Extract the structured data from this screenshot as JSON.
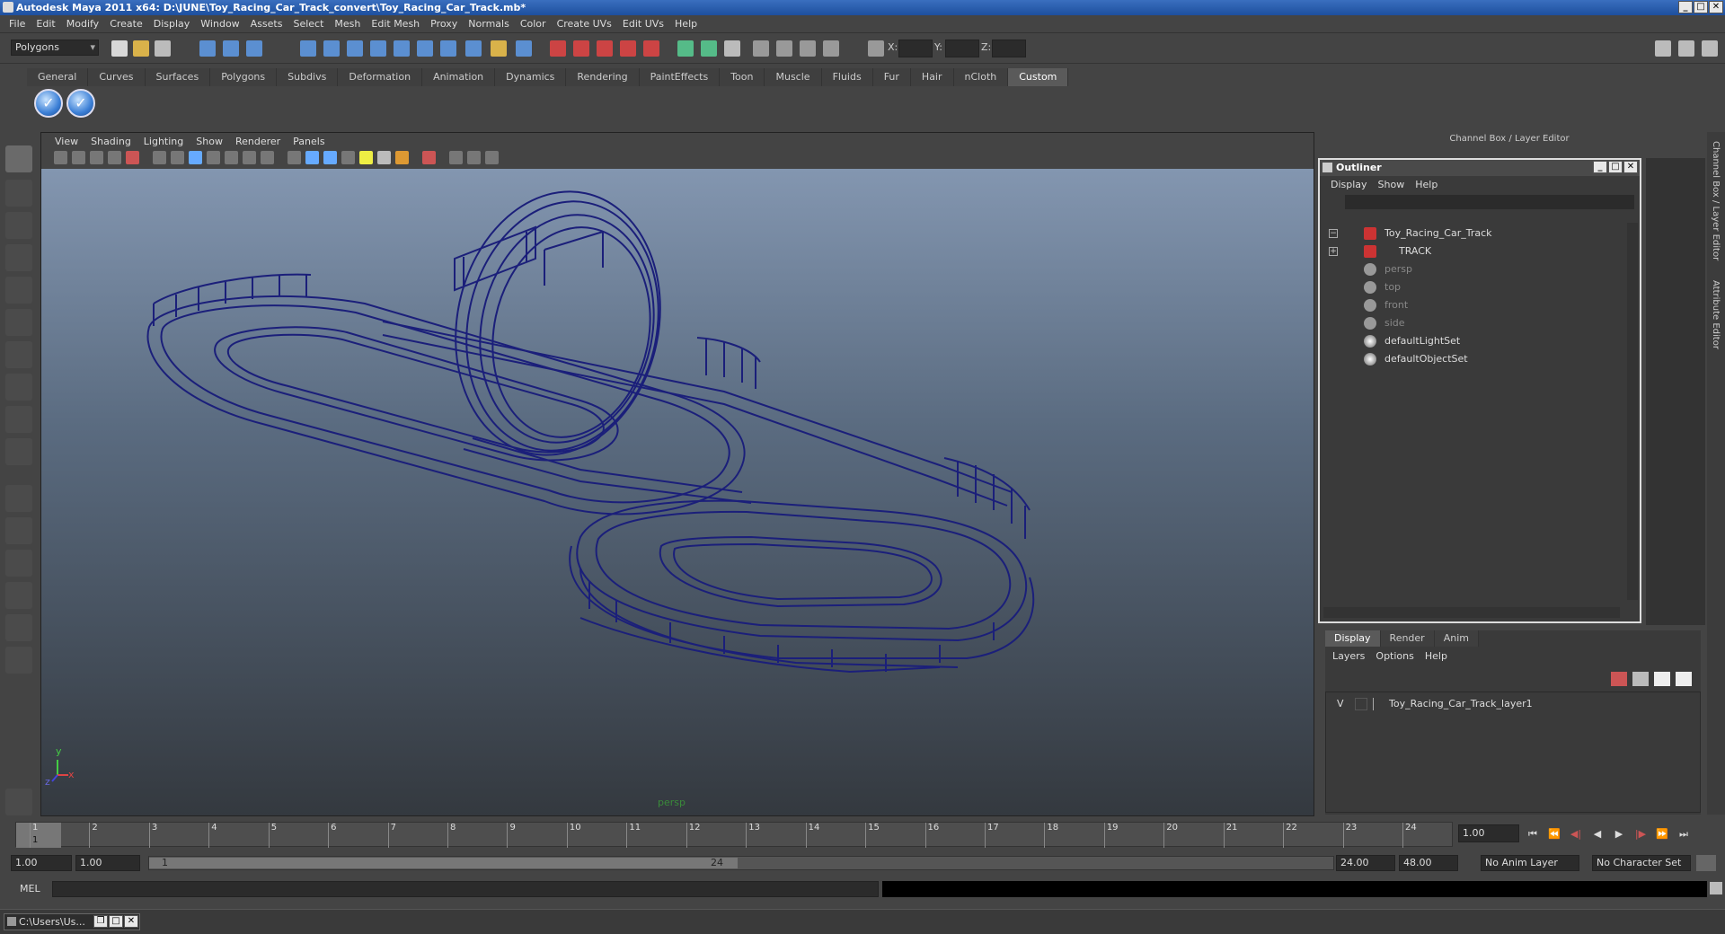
{
  "window": {
    "title": "Autodesk Maya 2011 x64: D:\\JUNE\\Toy_Racing_Car_Track_convert\\Toy_Racing_Car_Track.mb*"
  },
  "menubar": [
    "File",
    "Edit",
    "Modify",
    "Create",
    "Display",
    "Window",
    "Assets",
    "Select",
    "Mesh",
    "Edit Mesh",
    "Proxy",
    "Normals",
    "Color",
    "Create UVs",
    "Edit UVs",
    "Help"
  ],
  "statusline": {
    "mode": "Polygons",
    "x_label": "X:",
    "y_label": "Y:",
    "z_label": "Z:"
  },
  "shelf": {
    "tabs": [
      "General",
      "Curves",
      "Surfaces",
      "Polygons",
      "Subdivs",
      "Deformation",
      "Animation",
      "Dynamics",
      "Rendering",
      "PaintEffects",
      "Toon",
      "Muscle",
      "Fluids",
      "Fur",
      "Hair",
      "nCloth",
      "Custom"
    ],
    "active": "Custom"
  },
  "viewport": {
    "menu": [
      "View",
      "Shading",
      "Lighting",
      "Show",
      "Renderer",
      "Panels"
    ],
    "camera": "persp",
    "axis_y": "y",
    "axis_x": "x",
    "axis_z": "z",
    "wire_color": "#1b1f7a"
  },
  "channelbox": {
    "header": "Channel Box / Layer Editor",
    "side_tab_1": "Channel Box / Layer Editor",
    "side_tab_2": "Attribute Editor"
  },
  "outliner": {
    "title": "Outliner",
    "menu": [
      "Display",
      "Show",
      "Help"
    ],
    "items": [
      {
        "label": "Toy_Racing_Car_Track",
        "dim": false
      },
      {
        "label": "TRACK",
        "dim": false
      },
      {
        "label": "persp",
        "dim": true
      },
      {
        "label": "top",
        "dim": true
      },
      {
        "label": "front",
        "dim": true
      },
      {
        "label": "side",
        "dim": true
      },
      {
        "label": "defaultLightSet",
        "dim": false
      },
      {
        "label": "defaultObjectSet",
        "dim": false
      }
    ]
  },
  "layereditor": {
    "tabs": [
      "Display",
      "Render",
      "Anim"
    ],
    "active": "Display",
    "menu": [
      "Layers",
      "Options",
      "Help"
    ],
    "layers": [
      {
        "visible": "V",
        "name": "Toy_Racing_Car_Track_layer1"
      }
    ]
  },
  "timeslider": {
    "ticks": [
      1,
      2,
      3,
      4,
      5,
      6,
      7,
      8,
      9,
      10,
      11,
      12,
      13,
      14,
      15,
      16,
      17,
      18,
      19,
      20,
      21,
      22,
      23,
      24
    ],
    "current_marker": "1",
    "current_frame": "1.00"
  },
  "range": {
    "start": "1.00",
    "start2": "1.00",
    "handle_start": "1",
    "handle_end": "24",
    "end": "24.00",
    "end2": "48.00",
    "anim_layer": "No Anim Layer",
    "char_set": "No Character Set"
  },
  "mel": {
    "label": "MEL"
  },
  "taskbar": {
    "item": "C:\\Users\\Us..."
  }
}
